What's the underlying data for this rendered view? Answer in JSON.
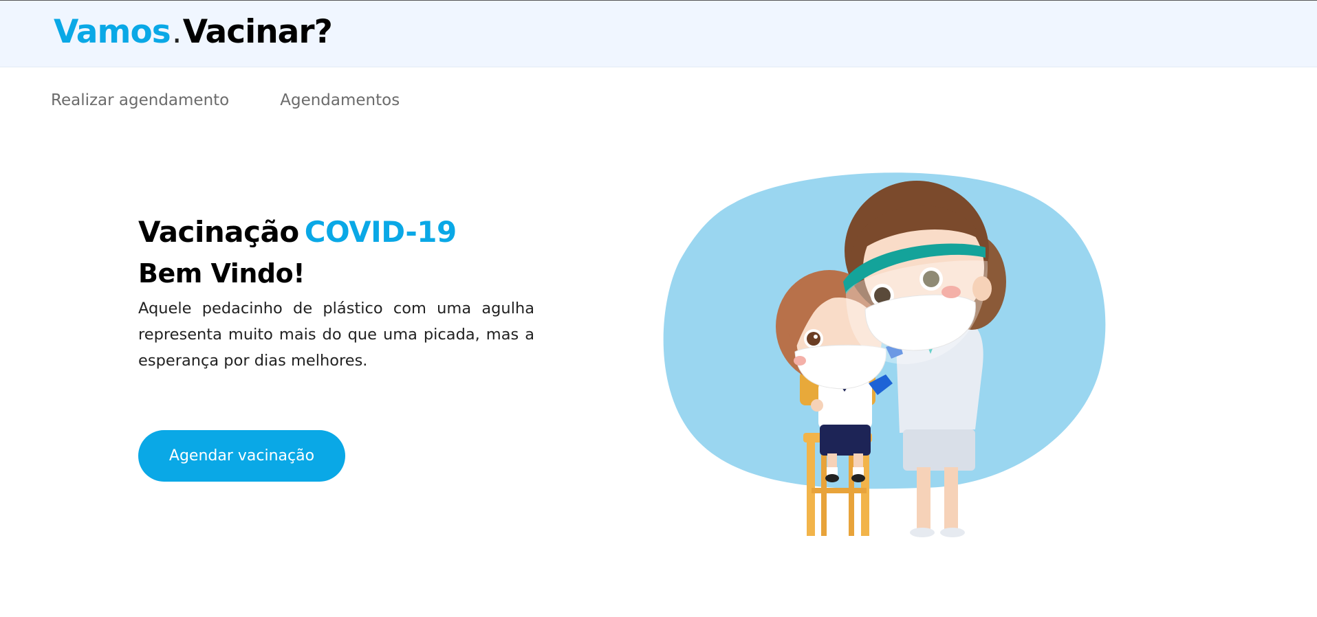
{
  "header": {
    "logo_part1": "Vamos",
    "logo_dot": ".",
    "logo_part2": "Vacinar?"
  },
  "nav": {
    "items": [
      {
        "label": "Realizar agendamento"
      },
      {
        "label": "Agendamentos"
      }
    ]
  },
  "hero": {
    "title_part1": "Vacinação",
    "title_part2": "COVID-19",
    "welcome": "Bem Vindo!",
    "description": "Aquele pedacinho de plástico com uma agulha representa muito mais do que uma picada, mas a esperança por dias melhores.",
    "cta_label": "Agendar vacinação"
  },
  "colors": {
    "accent": "#0aa8e6",
    "header_bg": "#f0f6ff",
    "blob": "#9ad6f0"
  },
  "illustration": {
    "icon": "nurse-vaccinating-child-illustration"
  }
}
